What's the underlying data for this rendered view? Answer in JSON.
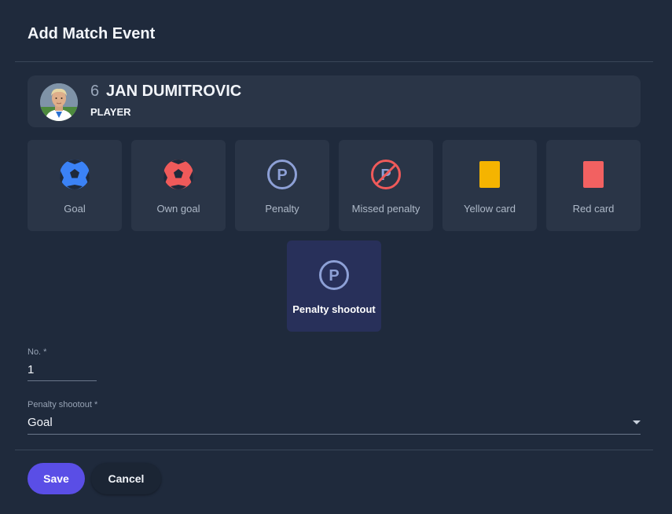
{
  "dialog": {
    "title": "Add Match Event"
  },
  "player": {
    "number": "6",
    "name": "JAN DUMITROVIC",
    "role": "PLAYER"
  },
  "events": [
    {
      "label": "Goal",
      "icon": "soccer-ball-icon",
      "color": "#3b82f6"
    },
    {
      "label": "Own goal",
      "icon": "soccer-ball-icon",
      "color": "#ef5a5a"
    },
    {
      "label": "Penalty",
      "icon": "penalty-icon",
      "color": "#8da0d6"
    },
    {
      "label": "Missed penalty",
      "icon": "missed-penalty-icon",
      "color": "#ef5a5a"
    },
    {
      "label": "Yellow card",
      "icon": "yellow-card-icon",
      "color": "#f5b400"
    },
    {
      "label": "Red card",
      "icon": "red-card-icon",
      "color": "#f26161"
    },
    {
      "label": "Penalty shootout",
      "icon": "penalty-icon",
      "color": "#8da0d6",
      "selected": true
    }
  ],
  "form": {
    "number_label": "No. *",
    "number_value": "1",
    "shootout_label": "Penalty shootout *",
    "shootout_value": "Goal"
  },
  "actions": {
    "save_label": "Save",
    "cancel_label": "Cancel"
  },
  "colors": {
    "accent": "#5a4ee6",
    "background": "#1f2a3c",
    "card": "#2a3547"
  }
}
